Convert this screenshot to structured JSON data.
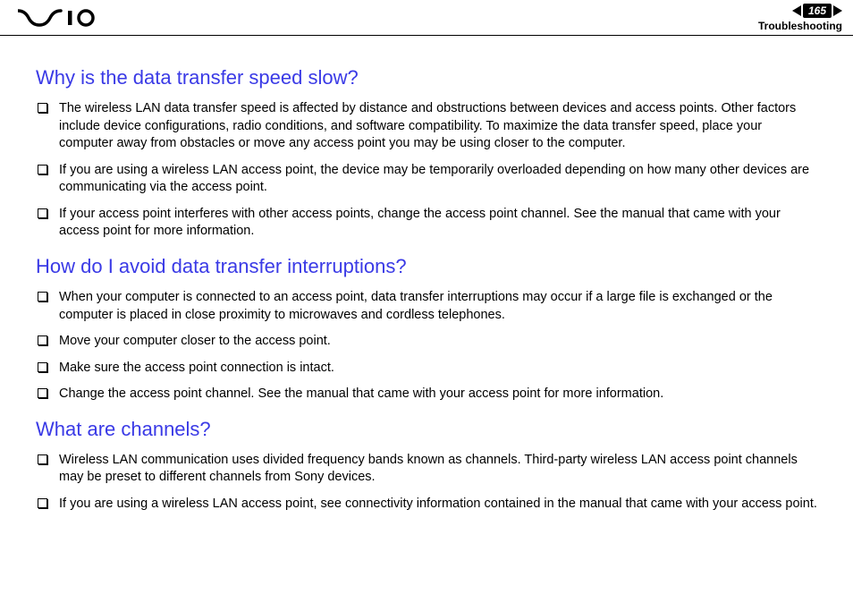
{
  "header": {
    "page_number": "165",
    "section": "Troubleshooting"
  },
  "sections": [
    {
      "title": "Why is the data transfer speed slow?",
      "items": [
        "The wireless LAN data transfer speed is affected by distance and obstructions between devices and access points. Other factors include device configurations, radio conditions, and software compatibility. To maximize the data transfer speed, place your computer away from obstacles or move any access point you may be using closer to the computer.",
        "If you are using a wireless LAN access point, the device may be temporarily overloaded depending on how many other devices are communicating via the access point.",
        "If your access point interferes with other access points, change the access point channel. See the manual that came with your access point for more information."
      ]
    },
    {
      "title": "How do I avoid data transfer interruptions?",
      "items": [
        "When your computer is connected to an access point, data transfer interruptions may occur if a large file is exchanged or the computer is placed in close proximity to microwaves and cordless telephones.",
        "Move your computer closer to the access point.",
        "Make sure the access point connection is intact.",
        "Change the access point channel. See the manual that came with your access point for more information."
      ]
    },
    {
      "title": "What are channels?",
      "items": [
        "Wireless LAN communication uses divided frequency bands known as channels. Third-party wireless LAN access point channels may be preset to different channels from Sony devices.",
        "If you are using a wireless LAN access point, see connectivity information contained in the manual that came with your access point."
      ]
    }
  ]
}
